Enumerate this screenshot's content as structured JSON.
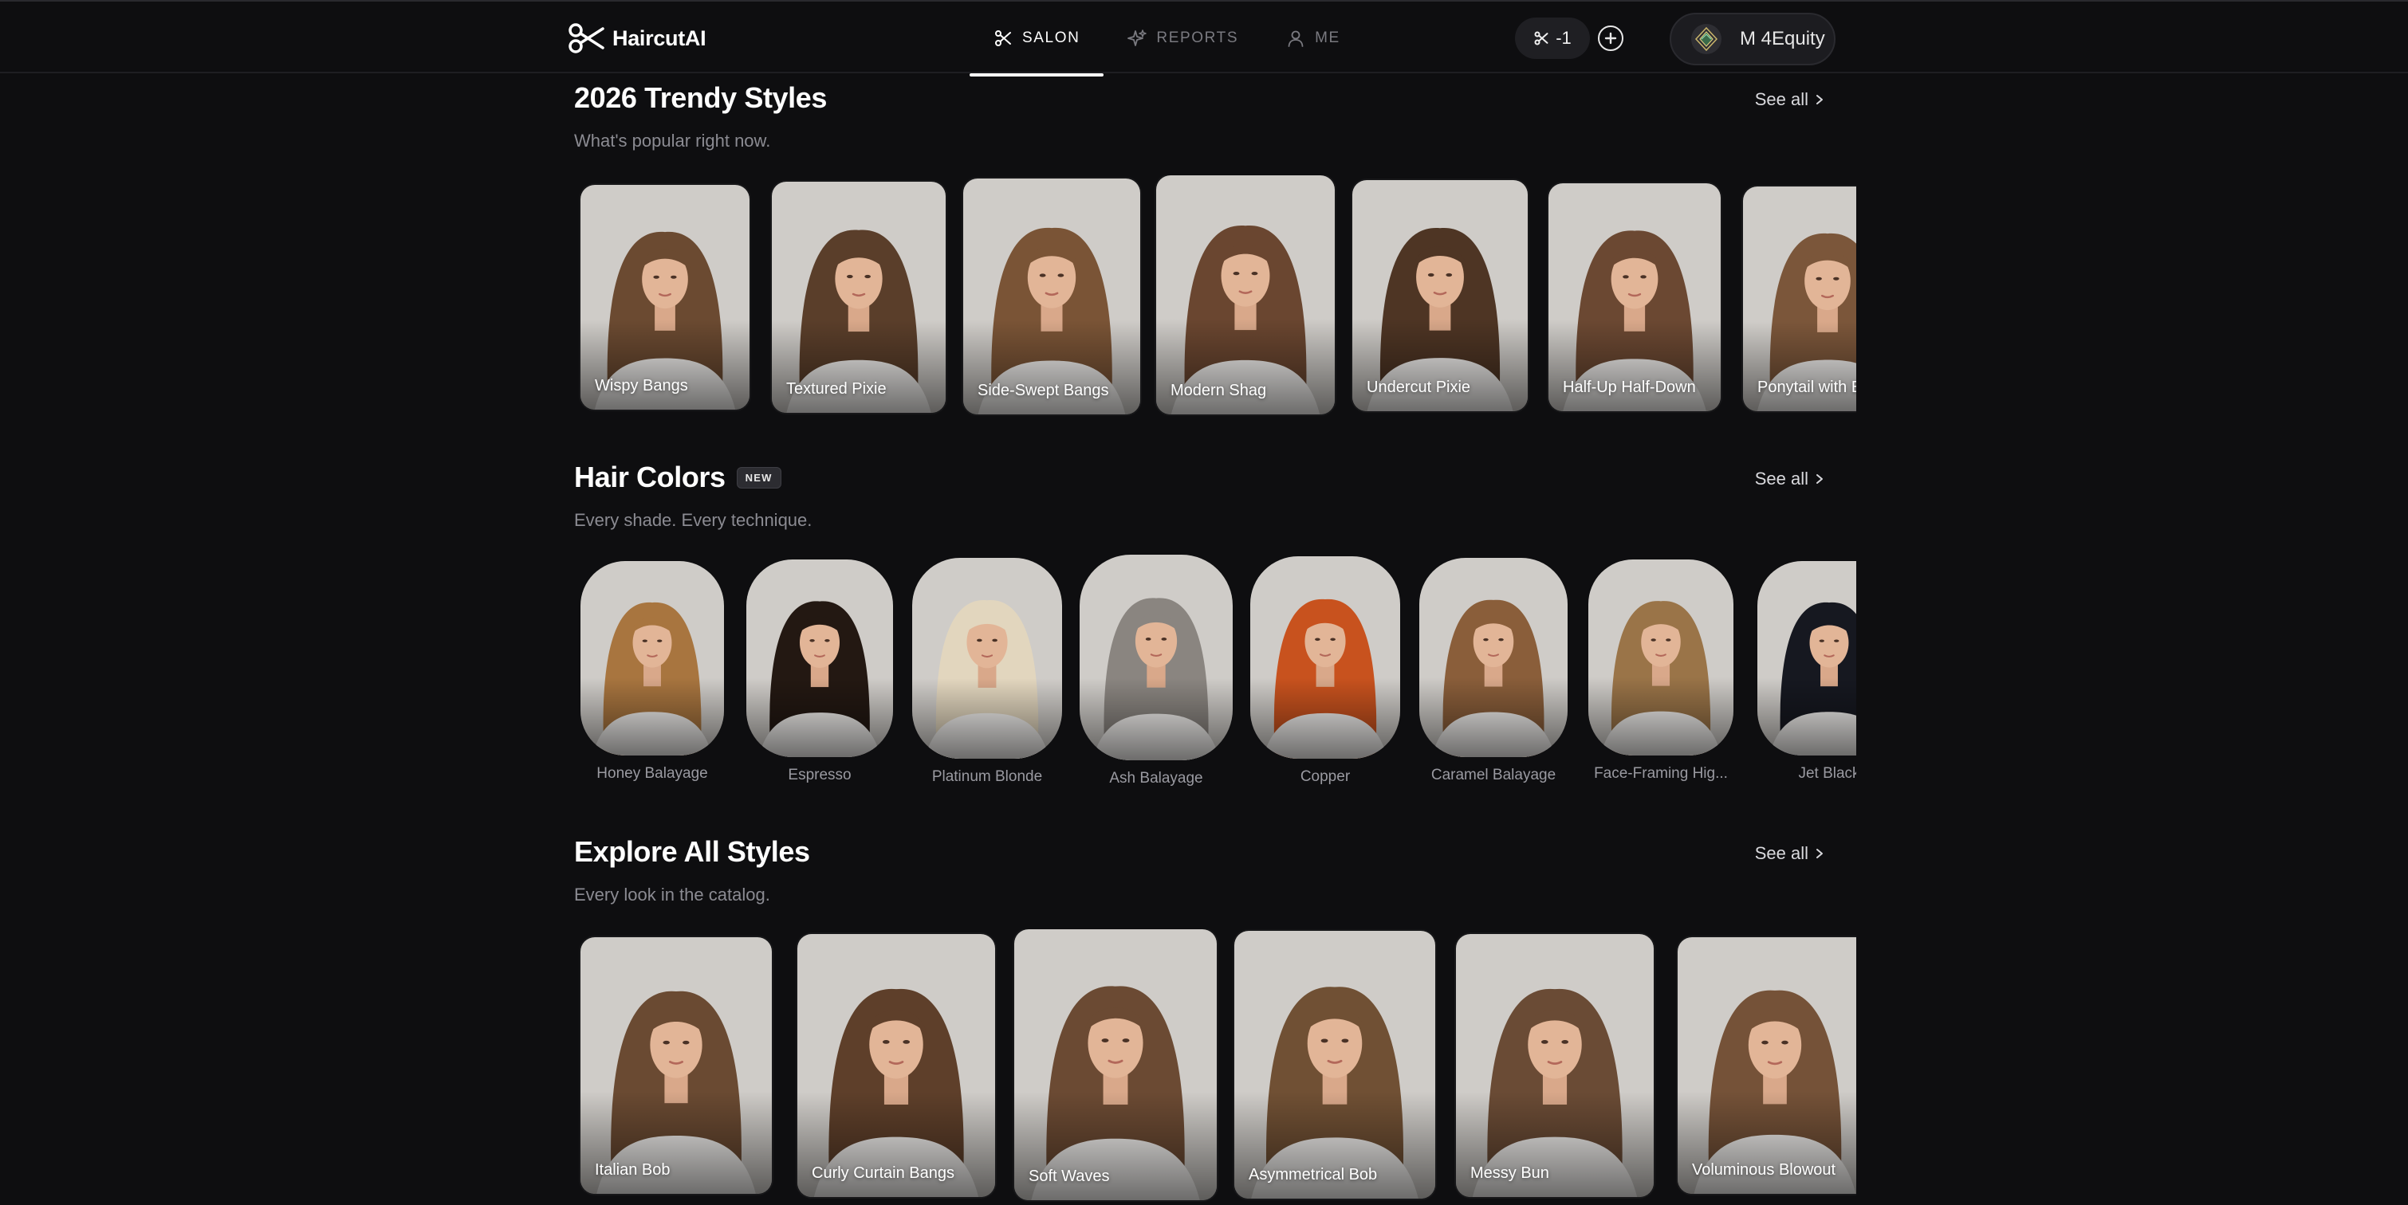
{
  "app": {
    "name": "HaircutAI"
  },
  "nav": {
    "tabs": [
      {
        "label": "SALON",
        "active": true
      },
      {
        "label": "REPORTS",
        "active": false
      },
      {
        "label": "ME",
        "active": false
      }
    ]
  },
  "credits": {
    "value": "-1"
  },
  "account": {
    "name": "M 4Equity"
  },
  "trendy": {
    "title": "2026 Trendy Styles",
    "subtitle": "What's popular right now.",
    "see_all": "See all",
    "items": [
      {
        "label": "Wispy Bangs",
        "hair": "#6b4a31"
      },
      {
        "label": "Textured Pixie",
        "hair": "#5a3e2a"
      },
      {
        "label": "Side-Swept Bangs",
        "hair": "#7a5436"
      },
      {
        "label": "Modern Shag",
        "hair": "#6a4630"
      },
      {
        "label": "Undercut Pixie",
        "hair": "#4e3524"
      },
      {
        "label": "Half-Up Half-Down",
        "hair": "#6b4832"
      },
      {
        "label": "Ponytail with Bangs",
        "hair": "#7b563a"
      }
    ]
  },
  "colors": {
    "title": "Hair Colors",
    "badge": "NEW",
    "subtitle": "Every shade. Every technique.",
    "see_all": "See all",
    "items": [
      {
        "label": "Honey Balayage",
        "hair": "#a8753f"
      },
      {
        "label": "Espresso",
        "hair": "#231812"
      },
      {
        "label": "Platinum Blonde",
        "hair": "#e2d6be"
      },
      {
        "label": "Ash Balayage",
        "hair": "#8a8580"
      },
      {
        "label": "Copper",
        "hair": "#c8521e"
      },
      {
        "label": "Caramel Balayage",
        "hair": "#8a5e3a"
      },
      {
        "label": "Face-Framing Hig...",
        "hair": "#9a7448"
      },
      {
        "label": "Jet Black",
        "hair": "#161820"
      }
    ]
  },
  "explore": {
    "title": "Explore All Styles",
    "subtitle": "Every look in the catalog.",
    "see_all": "See all",
    "items": [
      {
        "label": "Italian Bob",
        "hair": "#6a4a32"
      },
      {
        "label": "Curly Curtain Bangs",
        "hair": "#5e3f2a"
      },
      {
        "label": "Soft Waves",
        "hair": "#6b4a33"
      },
      {
        "label": "Asymmetrical Bob",
        "hair": "#705034"
      },
      {
        "label": "Messy Bun",
        "hair": "#6a4b35"
      },
      {
        "label": "Voluminous Blowout",
        "hair": "#755238"
      }
    ]
  }
}
